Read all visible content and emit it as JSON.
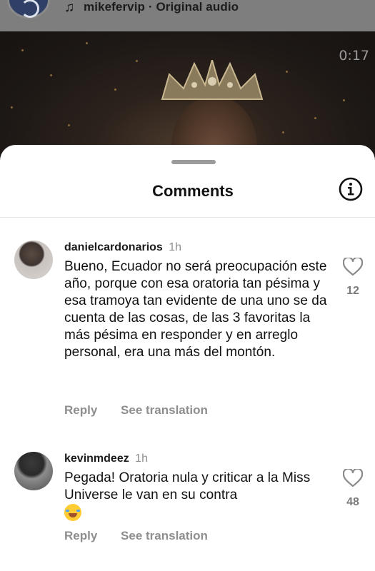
{
  "header": {
    "audio_label": "mikefervip · Original audio",
    "video_time": "0:17",
    "icons": {
      "music": "music-note-icon"
    }
  },
  "sheet": {
    "title": "Comments",
    "icons": {
      "info": "info-icon"
    }
  },
  "comments": [
    {
      "username": "danielcardonarios",
      "time": "1h",
      "text": "Bueno, Ecuador no será preocupación este año, porque con esa oratoria tan pésima y esa tramoya tan evidente de una uno se da cuenta de las cosas, de las 3 favoritas la más pésima en responder y en arreglo personal, era una más del montón.",
      "likes": "12",
      "reply_label": "Reply",
      "translate_label": "See translation"
    },
    {
      "username": "kevinmdeez",
      "time": "1h",
      "text": "Pegada! Oratoria nula y criticar a la Miss Universe le van en su contra",
      "emoji": "😂",
      "likes": "48",
      "reply_label": "Reply",
      "translate_label": "See translation"
    }
  ],
  "colors": {
    "meta_gray": "#8e8e8e",
    "text": "#111111",
    "divider": "#e6e6e6"
  }
}
